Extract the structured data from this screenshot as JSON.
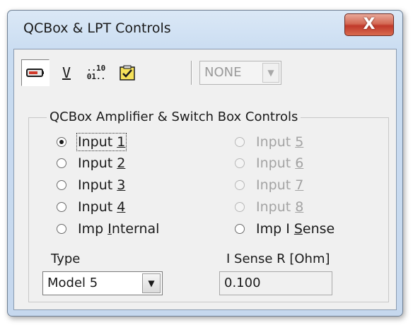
{
  "window": {
    "title": "QCBox & LPT Controls",
    "close_glyph": "X"
  },
  "toolbar": {
    "buttons": [
      {
        "icon": "amplifier-icon",
        "pressed": true
      },
      {
        "icon": "voltage-icon",
        "glyph": "V"
      },
      {
        "icon": "numeric-display-icon",
        "top": "..10",
        "bottom": "01.."
      },
      {
        "icon": "checklist-icon"
      }
    ],
    "channel_select": {
      "value": "NONE",
      "enabled": false
    }
  },
  "group": {
    "label": "QCBox Amplifier & Switch Box Controls",
    "radios": [
      {
        "pre": "Input ",
        "u": "1",
        "post": "",
        "checked": true,
        "enabled": true
      },
      {
        "pre": "Input ",
        "u": "2",
        "post": "",
        "checked": false,
        "enabled": true
      },
      {
        "pre": "Input ",
        "u": "3",
        "post": "",
        "checked": false,
        "enabled": true
      },
      {
        "pre": "Input ",
        "u": "4",
        "post": "",
        "checked": false,
        "enabled": true
      },
      {
        "pre": "Imp ",
        "u": "I",
        "post": "nternal",
        "checked": false,
        "enabled": true
      },
      {
        "pre": "Input ",
        "u": "5",
        "post": "",
        "checked": false,
        "enabled": false
      },
      {
        "pre": "Input ",
        "u": "6",
        "post": "",
        "checked": false,
        "enabled": false
      },
      {
        "pre": "Input ",
        "u": "7",
        "post": "",
        "checked": false,
        "enabled": false
      },
      {
        "pre": "Input ",
        "u": "8",
        "post": "",
        "checked": false,
        "enabled": false
      },
      {
        "pre": "Imp I ",
        "u": "S",
        "post": "ense",
        "checked": false,
        "enabled": true
      }
    ],
    "type_label": "Type",
    "type_value": "Model 5",
    "isense_label": "I Sense R [Ohm]",
    "isense_value": "0.100"
  },
  "colors": {
    "close_button": "#c0392b",
    "client_bg": "#f0f0f0",
    "disabled_text": "#a3a3a3"
  }
}
